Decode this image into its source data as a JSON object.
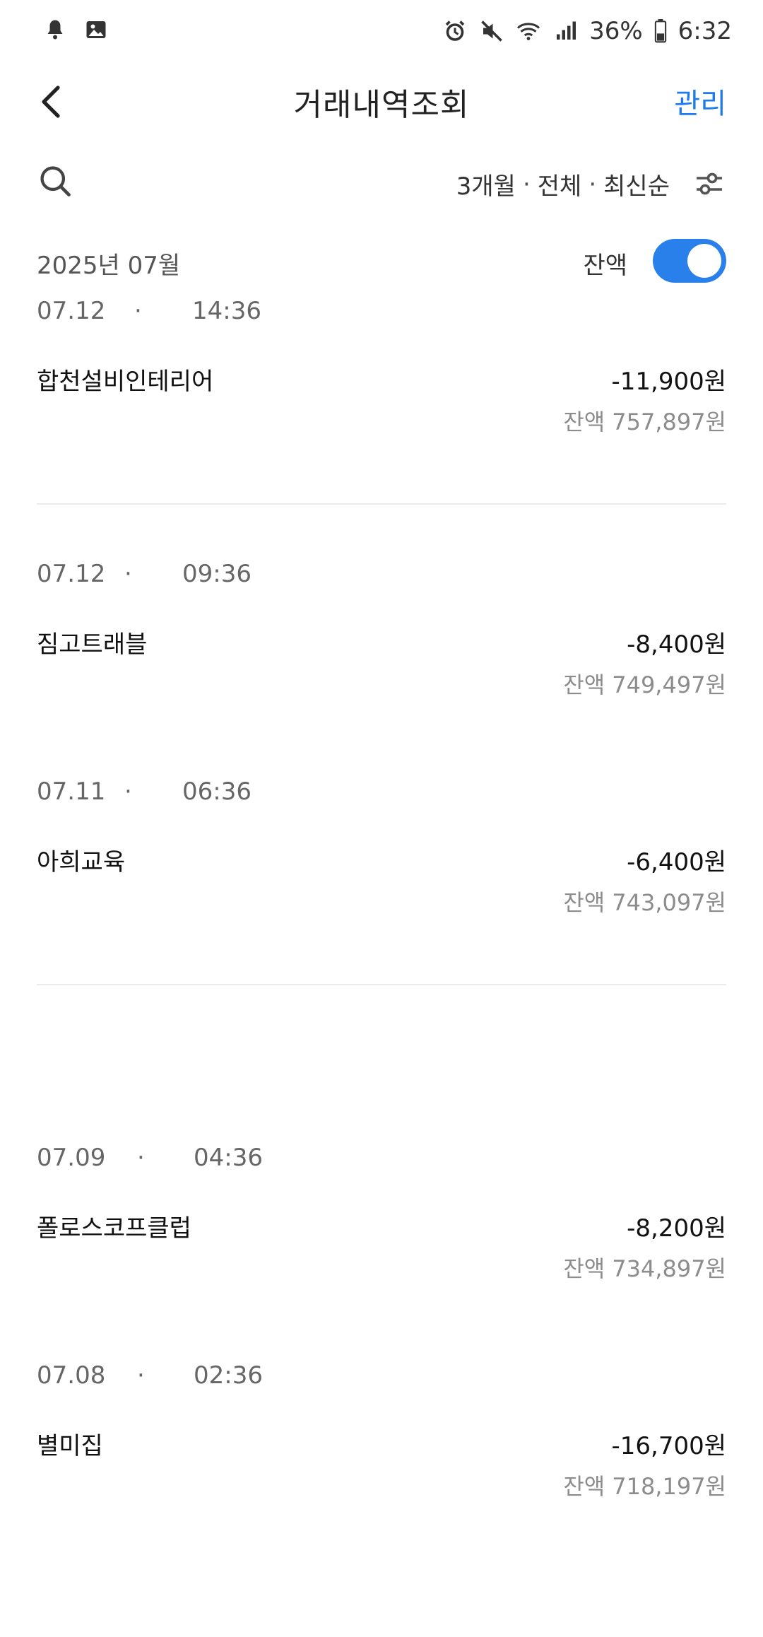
{
  "status_bar": {
    "left_icons": [
      "bell-icon",
      "image-icon"
    ],
    "right_icons": [
      "alarm-icon",
      "mute-icon",
      "wifi-icon",
      "signal-icon"
    ],
    "battery": "36%",
    "time": "6:32"
  },
  "header": {
    "title": "거래내역조회",
    "manage_label": "관리"
  },
  "filter": {
    "period": "3개월",
    "sep1": "·",
    "type": "전체",
    "sep2": "·",
    "sort": "최신순"
  },
  "month": {
    "label": "2025년 07월",
    "balance_toggle_label": "잔액",
    "balance_toggle_on": true
  },
  "balance_prefix": "잔액",
  "transactions": [
    {
      "date": "07.12",
      "sep": "·",
      "time": "14:36",
      "merchant": "합천설비인테리어",
      "amount": "-11,900원",
      "balance": "757,897원"
    },
    {
      "date": "07.12",
      "sep": "·",
      "time": "09:36",
      "merchant": "짐고트래블",
      "amount": "-8,400원",
      "balance": "749,497원"
    },
    {
      "date": "07.11",
      "sep": "·",
      "time": "06:36",
      "merchant": "아희교육",
      "amount": "-6,400원",
      "balance": "743,097원"
    },
    {
      "date": "07.09",
      "sep": "·",
      "time": "04:36",
      "merchant": "폴로스코프클럽",
      "amount": "-8,200원",
      "balance": "734,897원"
    },
    {
      "date": "07.08",
      "sep": "·",
      "time": "02:36",
      "merchant": "별미집",
      "amount": "-16,700원",
      "balance": "718,197원"
    }
  ],
  "colors": {
    "accent": "#1e7bef",
    "toggle": "#2a80ea",
    "muted_text": "#8c8c8c",
    "divider": "#ececec"
  }
}
